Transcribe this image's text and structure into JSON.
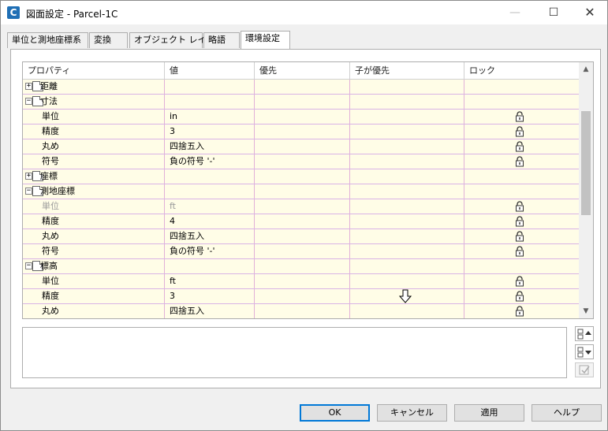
{
  "window": {
    "title": "図面設定 - Parcel-1C",
    "app_icon_letter": "C",
    "minimize_glyph": "—",
    "maximize_glyph": "☐",
    "close_glyph": "✕"
  },
  "tabs": [
    {
      "label": "単位と測地座標系"
    },
    {
      "label": "変換"
    },
    {
      "label": "オブジェクト レイヤ"
    },
    {
      "label": "略語"
    },
    {
      "label": "環境設定",
      "active": true
    }
  ],
  "grid": {
    "columns": [
      "プロパティ",
      "値",
      "優先",
      "子が優先",
      "ロック"
    ],
    "rows": [
      {
        "type": "category",
        "expander": "+",
        "label": "距離"
      },
      {
        "type": "category",
        "expander": "−",
        "label": "寸法"
      },
      {
        "type": "property",
        "label": "単位",
        "value": "in",
        "lock": true
      },
      {
        "type": "property",
        "label": "精度",
        "value": "3",
        "lock": true
      },
      {
        "type": "property",
        "label": "丸め",
        "value": "四捨五入",
        "lock": true
      },
      {
        "type": "property",
        "label": "符号",
        "value": "負の符号 '-'",
        "lock": true
      },
      {
        "type": "category",
        "expander": "+",
        "label": "座標"
      },
      {
        "type": "category",
        "expander": "−",
        "label": "測地座標"
      },
      {
        "type": "property",
        "label": "単位",
        "value": "ft",
        "lock": true,
        "disabled": true
      },
      {
        "type": "property",
        "label": "精度",
        "value": "4",
        "lock": true
      },
      {
        "type": "property",
        "label": "丸め",
        "value": "四捨五入",
        "lock": true
      },
      {
        "type": "property",
        "label": "符号",
        "value": "負の符号 '-'",
        "lock": true
      },
      {
        "type": "category",
        "expander": "−",
        "label": "標高"
      },
      {
        "type": "property",
        "label": "単位",
        "value": "ft",
        "lock": true
      },
      {
        "type": "property",
        "label": "精度",
        "value": "3",
        "lock": true
      },
      {
        "type": "property",
        "label": "丸め",
        "value": "四捨五入",
        "lock": true
      }
    ],
    "scroll_up_glyph": "▲",
    "scroll_down_glyph": "▼"
  },
  "buttons": {
    "ok": "OK",
    "cancel": "キャンセル",
    "apply": "適用",
    "help": "ヘルプ"
  },
  "colors": {
    "grid_background": "#fffde7",
    "row_divider": "#d9b3e6",
    "accent": "#0078d7"
  }
}
